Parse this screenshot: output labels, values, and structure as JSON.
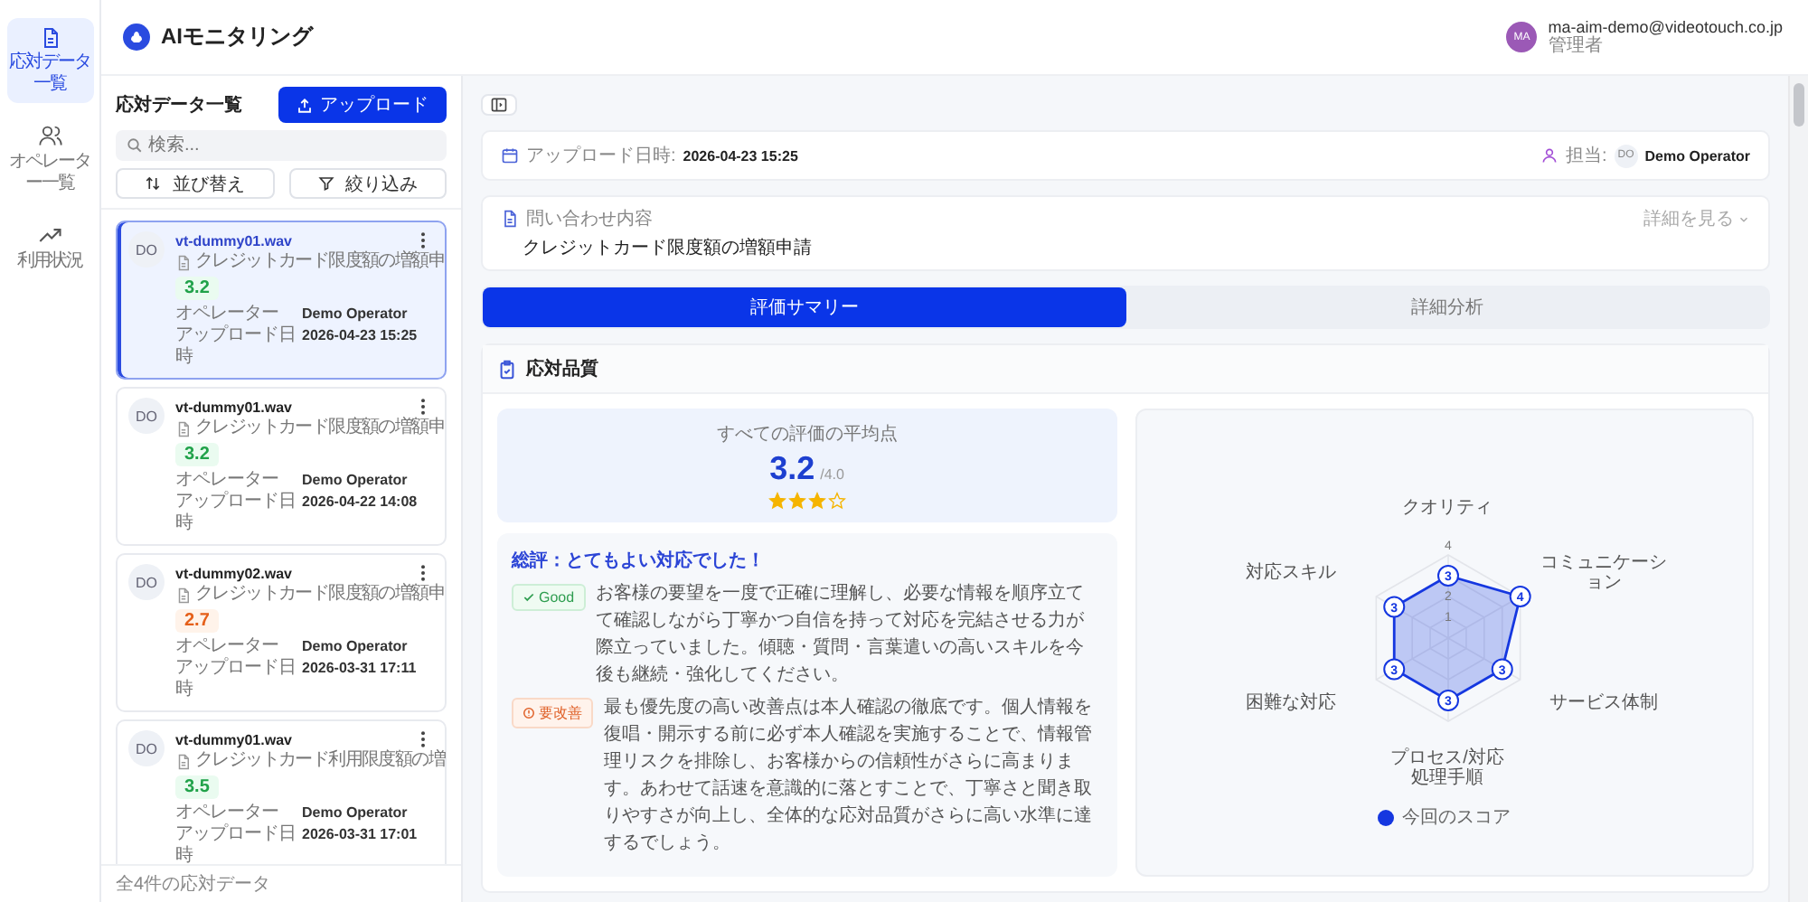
{
  "nav": {
    "items": [
      {
        "label": "応対データ一覧",
        "selected": true
      },
      {
        "label": "オペレーター一覧",
        "selected": false
      },
      {
        "label": "利用状況",
        "selected": false
      }
    ]
  },
  "header": {
    "title": "AIモニタリング",
    "user": {
      "initials": "MA",
      "email": "ma-aim-demo@videotouch.co.jp",
      "role": "管理者"
    }
  },
  "list": {
    "title": "応対データ一覧",
    "upload_button": "アップロード",
    "search": {
      "placeholder": "検索..."
    },
    "sort_button": "並び替え",
    "filter_button": "絞り込み",
    "items": [
      {
        "initials": "DO",
        "file": "vt-dummy01.wav",
        "inquiry": "クレジットカード限度額の増額申",
        "score": "3.2",
        "kind": "good",
        "operator_label": "オペレーター",
        "operator": "Demo Operator",
        "date_label": "アップロード日時",
        "date": "2026-04-23 15:25",
        "selected": true
      },
      {
        "initials": "DO",
        "file": "vt-dummy01.wav",
        "inquiry": "クレジットカード限度額の増額申",
        "score": "3.2",
        "kind": "good",
        "operator_label": "オペレーター",
        "operator": "Demo Operator",
        "date_label": "アップロード日時",
        "date": "2026-04-22 14:08",
        "selected": false
      },
      {
        "initials": "DO",
        "file": "vt-dummy02.wav",
        "inquiry": "クレジットカード限度額の増額申",
        "score": "2.7",
        "kind": "warn",
        "operator_label": "オペレーター",
        "operator": "Demo Operator",
        "date_label": "アップロード日時",
        "date": "2026-03-31 17:11",
        "selected": false
      },
      {
        "initials": "DO",
        "file": "vt-dummy01.wav",
        "inquiry": "クレジットカード利用限度額の増",
        "score": "3.5",
        "kind": "good",
        "operator_label": "オペレーター",
        "operator": "Demo Operator",
        "date_label": "アップロード日時",
        "date": "2026-03-31 17:01",
        "selected": false
      }
    ],
    "footer": "全4件の応対データ"
  },
  "detail": {
    "upload_label": "アップロード日時:",
    "upload_value": "2026-04-23 15:25",
    "assignee_label": "担当:",
    "assignee_initials": "DO",
    "assignee": "Demo Operator",
    "inquiry_label": "問い合わせ内容",
    "inquiry": "クレジットカード限度額の増額申請",
    "more": "詳細を見る",
    "tabs": [
      {
        "label": "評価サマリー",
        "selected": true
      },
      {
        "label": "詳細分析",
        "selected": false
      }
    ],
    "section": {
      "title": "応対品質",
      "average_label": "すべての評価の平均点",
      "average": "3.2",
      "max": "/4.0",
      "stars": 3,
      "comment_title": "総評：とてもよい対応でした！",
      "comments": [
        {
          "kind": "good",
          "badge": "Good",
          "text": "お客様の要望を一度で正確に理解し、必要な情報を順序立てて確認しながら丁寧かつ自信を持って対応を完結させる力が際立っていました。傾聴・質問・言葉遣いの高いスキルを今後も継続・強化してください。"
        },
        {
          "kind": "improve",
          "badge": "要改善",
          "text": "最も優先度の高い改善点は本人確認の徹底です。個人情報を復唱・開示する前に必ず本人確認を実施することで、情報管理リスクを排除し、お客様からの信頼性がさらに高まります。あわせて話速を意識的に落とすことで、丁寧さと聞き取りやすさが向上し、全体的な応対品質がさらに高い水準に達するでしょう。"
        }
      ],
      "radar": {
        "categories": [
          "クオリティ",
          "コミュニケーション",
          "サービス体制",
          "プロセス/対応処理手順",
          "困難な対応",
          "対応スキル"
        ],
        "scale_labels": [
          "4",
          "2",
          "1"
        ],
        "series": [
          {
            "name": "今回のスコア",
            "color": "#1537e0",
            "value_labels": [
              "3",
              "4",
              "3",
              "3",
              "3",
              "3"
            ]
          }
        ]
      }
    }
  }
}
